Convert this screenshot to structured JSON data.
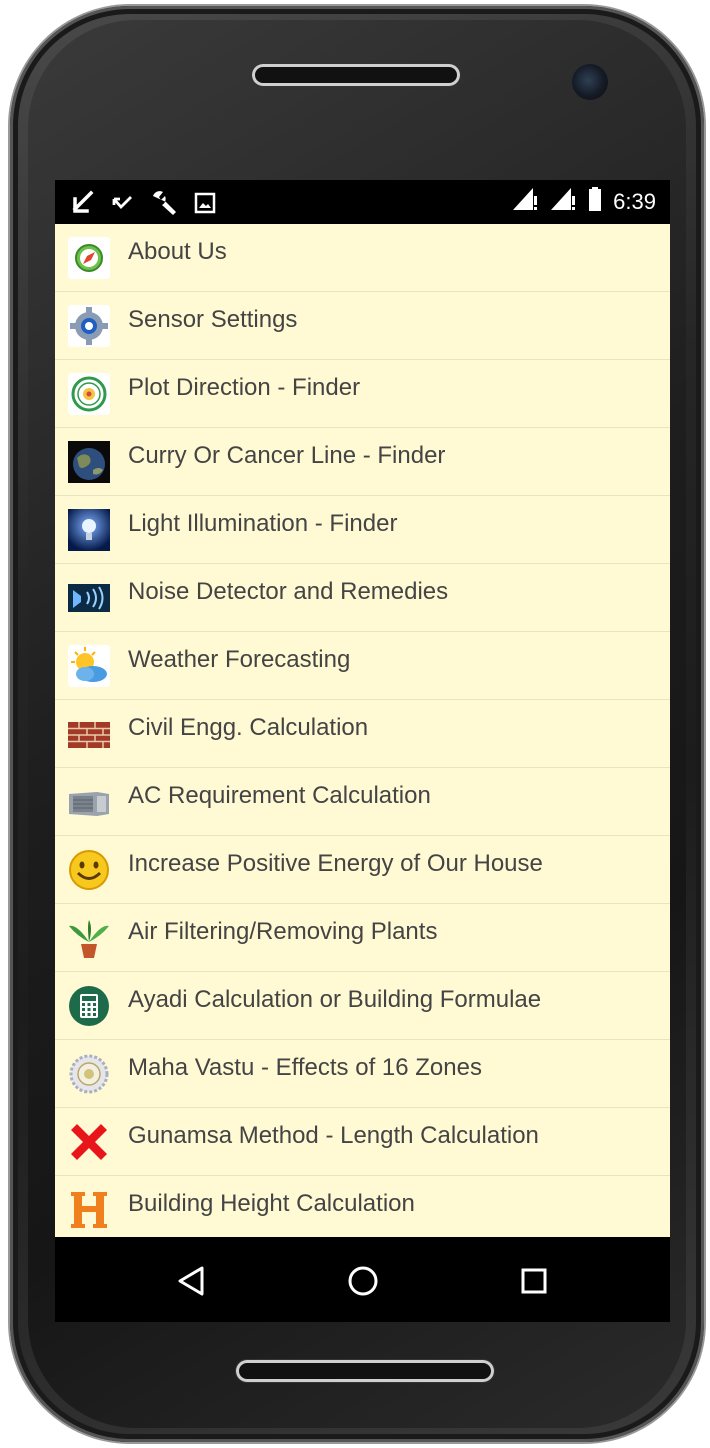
{
  "status_bar": {
    "time": "6:39",
    "left_icons": [
      "download-arrow-icon",
      "missed-call-icon",
      "wrench-icon",
      "image-icon"
    ],
    "right_icons": [
      "signal-icon",
      "signal-icon",
      "battery-icon"
    ]
  },
  "menu": {
    "items": [
      {
        "label": "About Us",
        "icon": "compass-icon"
      },
      {
        "label": "Sensor Settings",
        "icon": "gear-icon"
      },
      {
        "label": "Plot Direction - Finder",
        "icon": "compass-dial-icon"
      },
      {
        "label": "Curry Or Cancer Line - Finder",
        "icon": "globe-icon"
      },
      {
        "label": "Light Illumination - Finder",
        "icon": "light-bulb-icon"
      },
      {
        "label": "Noise Detector and Remedies",
        "icon": "sound-wave-icon"
      },
      {
        "label": "Weather Forecasting",
        "icon": "sun-cloud-icon"
      },
      {
        "label": "Civil Engg. Calculation",
        "icon": "brick-wall-icon"
      },
      {
        "label": "AC Requirement Calculation",
        "icon": "air-conditioner-icon"
      },
      {
        "label": "Increase Positive Energy of Our House",
        "icon": "smiley-icon"
      },
      {
        "label": "Air Filtering/Removing Plants",
        "icon": "plant-icon"
      },
      {
        "label": "Ayadi Calculation or Building Formulae",
        "icon": "calculator-icon"
      },
      {
        "label": "Maha Vastu - Effects of 16 Zones",
        "icon": "vastu-chakra-icon"
      },
      {
        "label": "Gunamsa Method - Length Calculation",
        "icon": "red-cross-icon"
      },
      {
        "label": "Building Height Calculation",
        "icon": "letter-h-icon"
      }
    ]
  },
  "nav_bar": {
    "buttons": [
      "back-icon",
      "home-icon",
      "recents-icon"
    ]
  },
  "colors": {
    "list_background": "#fffad4",
    "text": "#444444",
    "bars": "#000000"
  }
}
